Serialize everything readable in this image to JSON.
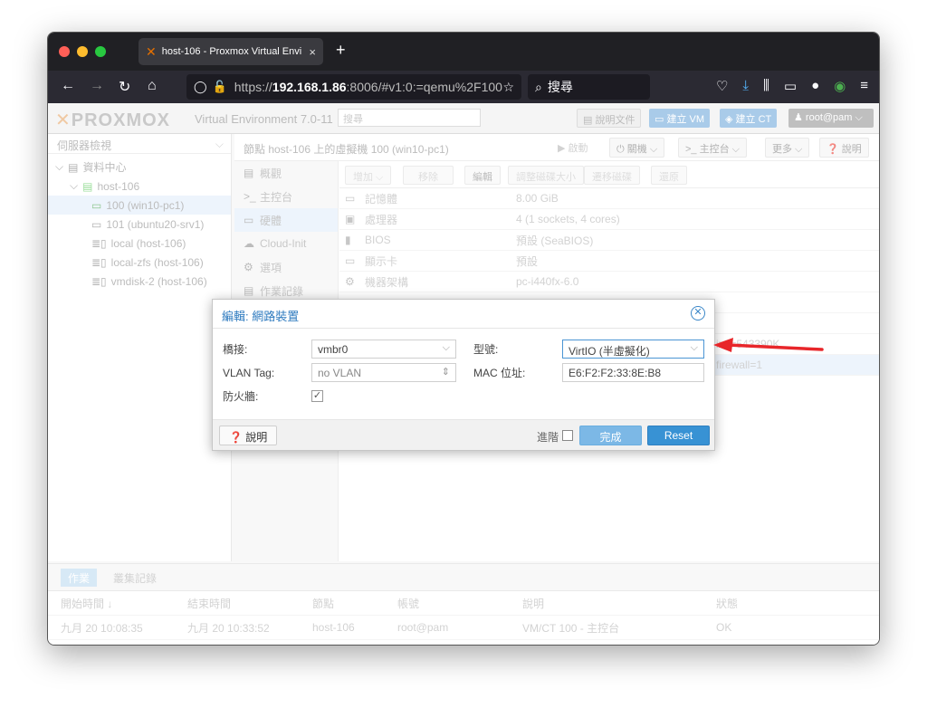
{
  "browser": {
    "tab_title": "host-106 - Proxmox Virtual Envi",
    "tab_close": "×",
    "new_tab": "+",
    "url_prefix": "https://",
    "url_host": "192.168.1.86",
    "url_rest": ":8006/#v1:0:=qemu%2F100",
    "search_placeholder": "搜尋",
    "colors": {
      "red": "#ff5f57",
      "yellow": "#febc2e",
      "green": "#28c840"
    }
  },
  "pve": {
    "logo": "PROXMOX",
    "version": "Virtual Environment 7.0-11",
    "search_placeholder": "搜尋",
    "docs": "說明文件",
    "create_vm": "建立 VM",
    "create_ct": "建立 CT",
    "user": "root@pam"
  },
  "sidebar": {
    "view": "伺服器檢視",
    "items": [
      {
        "label": "資料中心",
        "indent": 1
      },
      {
        "label": "host-106",
        "indent": 2
      },
      {
        "label": "100 (win10-pc1)",
        "indent": 3
      },
      {
        "label": "101 (ubuntu20-srv1)",
        "indent": 3
      },
      {
        "label": "local (host-106)",
        "indent": 3
      },
      {
        "label": "local-zfs (host-106)",
        "indent": 3
      },
      {
        "label": "vmdisk-2 (host-106)",
        "indent": 3
      }
    ]
  },
  "main": {
    "title": "節點 host-106 上的虛擬機 100 (win10-pc1)",
    "start": "啟動",
    "shutdown": "關機",
    "console": "主控台",
    "more": "更多",
    "help": "說明",
    "subnav": [
      "概觀",
      "主控台",
      "硬體",
      "Cloud-Init",
      "選項",
      "作業記錄"
    ],
    "toolbar": [
      "增加",
      "移除",
      "編輯",
      "調整磁碟大小",
      "遷移磁碟",
      "還原"
    ],
    "hardware": [
      {
        "label": "記憶體",
        "value": "8.00 GiB"
      },
      {
        "label": "處理器",
        "value": "4 (1 sockets, 4 cores)"
      },
      {
        "label": "BIOS",
        "value": "預設 (SeaBIOS)"
      },
      {
        "label": "顯示卡",
        "value": "預設"
      },
      {
        "label": "機器架構",
        "value": "pc-i440fx-6.0"
      }
    ],
    "partial_rows": [
      "ize=543390K",
      "firewall=1"
    ]
  },
  "dialog": {
    "title": "編輯: 網路裝置",
    "close": "⊗",
    "bridge_label": "橋接:",
    "bridge_value": "vmbr0",
    "vlan_label": "VLAN Tag:",
    "vlan_value": "no VLAN",
    "firewall_label": "防火牆:",
    "model_label": "型號:",
    "model_value": "VirtIO (半虛擬化)",
    "mac_label": "MAC 位址:",
    "mac_value": "E6:F2:F2:33:8E:B8",
    "help_btn": "說明",
    "advanced_label": "進階",
    "ok_btn": "完成",
    "reset_btn": "Reset"
  },
  "log": {
    "tabs": [
      "作業",
      "叢集記錄"
    ],
    "headers": [
      "開始時間 ↓",
      "結束時間",
      "節點",
      "帳號",
      "說明",
      "狀態"
    ],
    "rows": [
      {
        "start": "九月 20 10:08:35",
        "end": "九月 20 10:33:52",
        "node": "host-106",
        "user": "root@pam",
        "desc": "VM/CT 100 - 主控台",
        "status": "OK"
      }
    ]
  },
  "annotation_arrow_color": "#e8262a"
}
